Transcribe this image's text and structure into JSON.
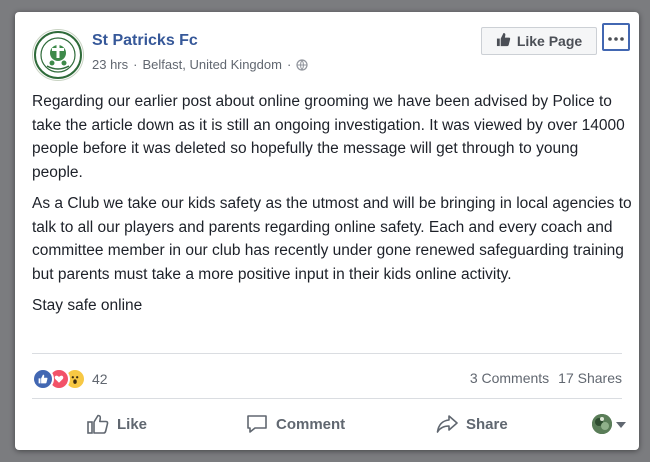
{
  "post": {
    "page_name": "St Patricks Fc",
    "time": "23 hrs",
    "location": "Belfast, United Kingdom",
    "separator": "·",
    "like_page_label": "Like Page",
    "paragraphs": [
      "Regarding our earlier post about online grooming we have been advised by Police to take the article down as it is still an ongoing investigation. It was viewed by over 14000 people before it was deleted so hopefully the message will get through to young people.",
      "As a Club we take our kids safety as the utmost and will be bringing in local agencies to talk to all our players and parents regarding online safety. Each and every coach and committee member in our club has recently under gone renewed safeguarding training but parents must take a more positive input in their kids online activity.",
      "Stay safe online"
    ]
  },
  "engagement": {
    "reaction_count": "42",
    "reactions": [
      "like-icon",
      "love-icon",
      "wow-icon"
    ],
    "comments": "3 Comments",
    "shares": "17 Shares"
  },
  "actions": {
    "like": "Like",
    "comment": "Comment",
    "share": "Share"
  },
  "colors": {
    "brand": "#365899",
    "like_blue": "#4267b2",
    "love_red": "#f25268",
    "wow_yellow": "#f7c844"
  }
}
